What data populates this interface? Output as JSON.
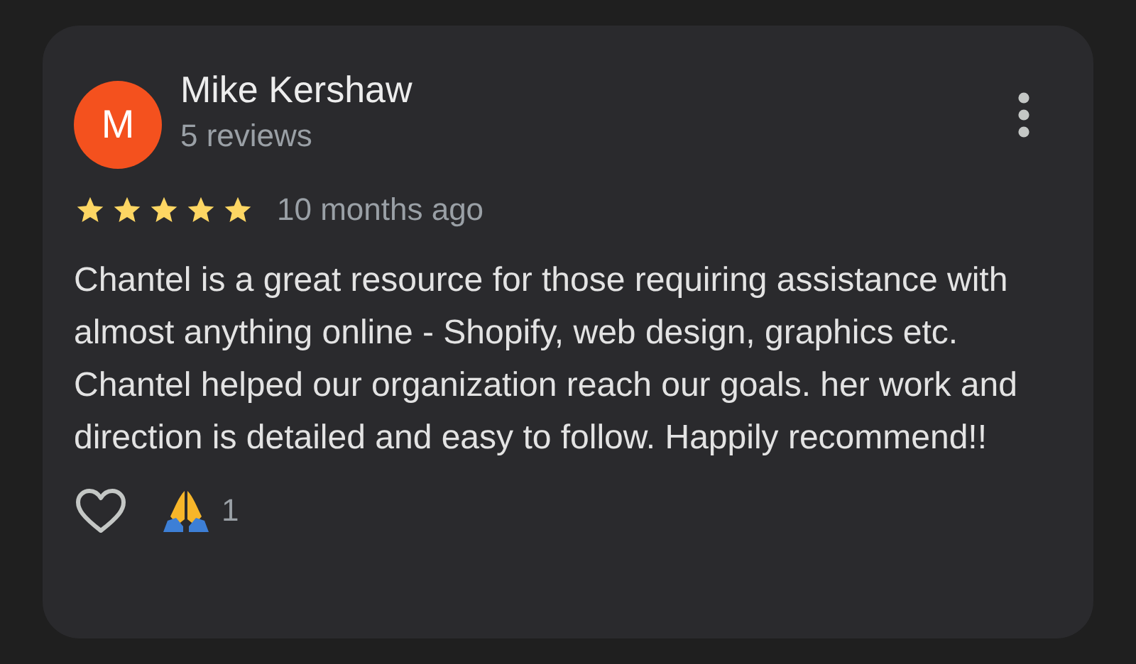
{
  "review": {
    "avatar_letter": "M",
    "author": "Mike Kershaw",
    "author_meta": "5 reviews",
    "stars": 5,
    "time": "10 months ago",
    "text": "Chantel is a great resource for those requiring assistance with almost anything online - Shopify, web design, graphics etc. Chantel helped our organization reach our goals. her work and direction is detailed and easy to follow. Happily recommend!!",
    "liked": false,
    "reaction_count": "1"
  }
}
